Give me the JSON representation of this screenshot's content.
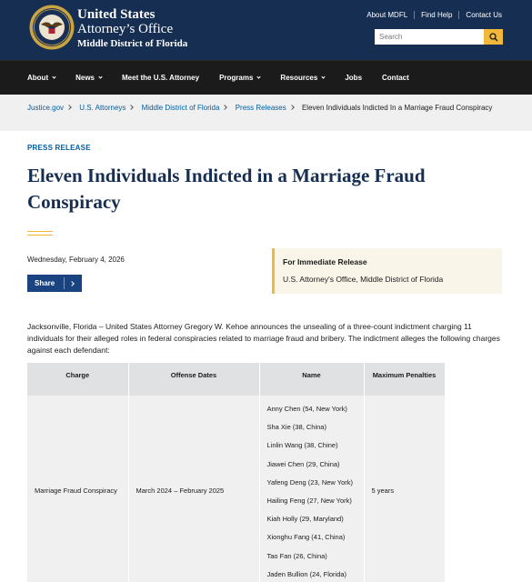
{
  "header": {
    "title_line1": "United States",
    "title_line2": "Attorney’s Office",
    "title_line3": "Middle District of Florida",
    "utility_links": [
      "About MDFL",
      "Find Help",
      "Contact Us"
    ],
    "search_placeholder": "Search"
  },
  "nav": {
    "items": [
      {
        "label": "About",
        "dropdown": true
      },
      {
        "label": "News",
        "dropdown": true
      },
      {
        "label": "Meet the U.S. Attorney",
        "dropdown": false
      },
      {
        "label": "Programs",
        "dropdown": true
      },
      {
        "label": "Resources",
        "dropdown": true
      },
      {
        "label": "Jobs",
        "dropdown": false
      },
      {
        "label": "Contact",
        "dropdown": false
      }
    ]
  },
  "breadcrumb": {
    "links": [
      "Justice.gov",
      "U.S. Attorneys",
      "Middle District of Florida",
      "Press Releases"
    ],
    "current": "Eleven Individuals Indicted In a Marriage Fraud Conspiracy"
  },
  "article": {
    "eyebrow": "PRESS RELEASE",
    "headline": "Eleven Individuals Indicted in a Marriage Fraud Conspiracy",
    "date": "Wednesday, February 4, 2026",
    "share_label": "Share",
    "release_title": "For Immediate Release",
    "release_office": "U.S. Attorney's Office, Middle District of Florida",
    "intro": "Jacksonville, Florida – United States Attorney Gregory W. Kehoe announces the  unsealing of a three-count indictment charging 11 individuals for their alleged roles in federal conspiracies related to marriage fraud and bribery. The indictment alleges the following charges against each defendant:"
  },
  "table": {
    "headers": [
      "Charge",
      "Offense Dates",
      "Name",
      "Maximum Penalties"
    ],
    "row": {
      "charge": "Marriage Fraud Conspiracy",
      "dates": "March 2024 – February 2025",
      "names": [
        "Anny Chen (54, New York)",
        "Sha Xie (38, China)",
        "Linlin Wang (38, Chine)",
        "Jiawei Chen (29, China)",
        "Yafeng Deng (23, New York)",
        "Hailing Feng (27, New York)",
        "Kiah Holly (29, Maryland)",
        "Xionghu Fang (41, China)",
        "Tao Fan (26, China)",
        "Jaden Bullion (24, Florida)"
      ],
      "penalty": "5 years"
    }
  },
  "colors": {
    "header_navy": "#162e51",
    "nav_black": "#1b1b1b",
    "accent_gold": "#f1b83a",
    "link_blue": "#005ea2",
    "share_blue": "#1a4480"
  },
  "icons": [
    "doj-seal",
    "search-icon",
    "chevron-down-icon",
    "chevron-right-icon"
  ]
}
